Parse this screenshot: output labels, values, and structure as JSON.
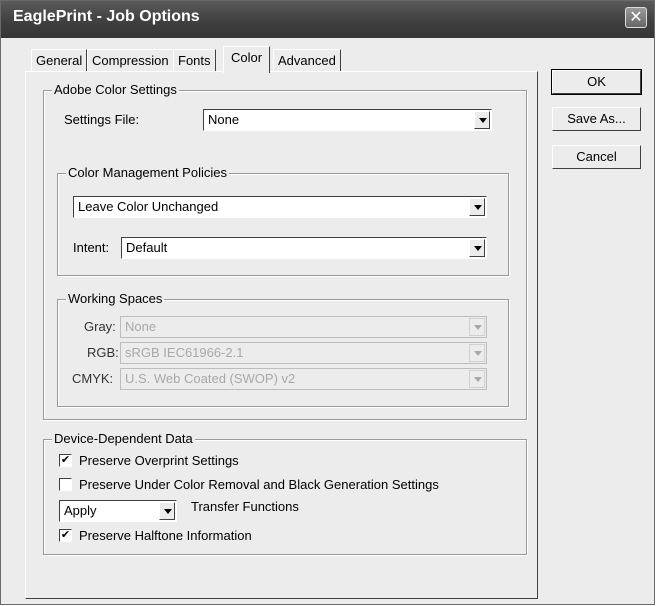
{
  "window": {
    "title": "EaglePrint - Job Options",
    "close_glyph": "✕"
  },
  "tabs": [
    {
      "label": "General"
    },
    {
      "label": "Compression"
    },
    {
      "label": "Fonts"
    },
    {
      "label": "Color",
      "active": true
    },
    {
      "label": "Advanced"
    }
  ],
  "adobe_color": {
    "legend": "Adobe Color Settings",
    "settings_file_label": "Settings File:",
    "settings_file_value": "None"
  },
  "policies": {
    "legend": "Color Management Policies",
    "policy_value": "Leave Color Unchanged",
    "intent_label": "Intent:",
    "intent_value": "Default"
  },
  "working_spaces": {
    "legend": "Working Spaces",
    "gray_label": "Gray:",
    "gray_value": "None",
    "rgb_label": "RGB:",
    "rgb_value": "sRGB IEC61966-2.1",
    "cmyk_label": "CMYK:",
    "cmyk_value": "U.S. Web Coated (SWOP) v2"
  },
  "device_data": {
    "legend": "Device-Dependent Data",
    "preserve_overprint": {
      "label": "Preserve Overprint Settings",
      "checked": true,
      "mark": "✔"
    },
    "preserve_ucr": {
      "label": "Preserve Under Color Removal and Black Generation Settings",
      "checked": false,
      "mark": ""
    },
    "transfer_select_value": "Apply",
    "transfer_label": "Transfer Functions",
    "preserve_halftone": {
      "label": "Preserve Halftone Information",
      "checked": true,
      "mark": "✔"
    }
  },
  "buttons": {
    "ok": "OK",
    "save_as": "Save As...",
    "cancel": "Cancel"
  }
}
